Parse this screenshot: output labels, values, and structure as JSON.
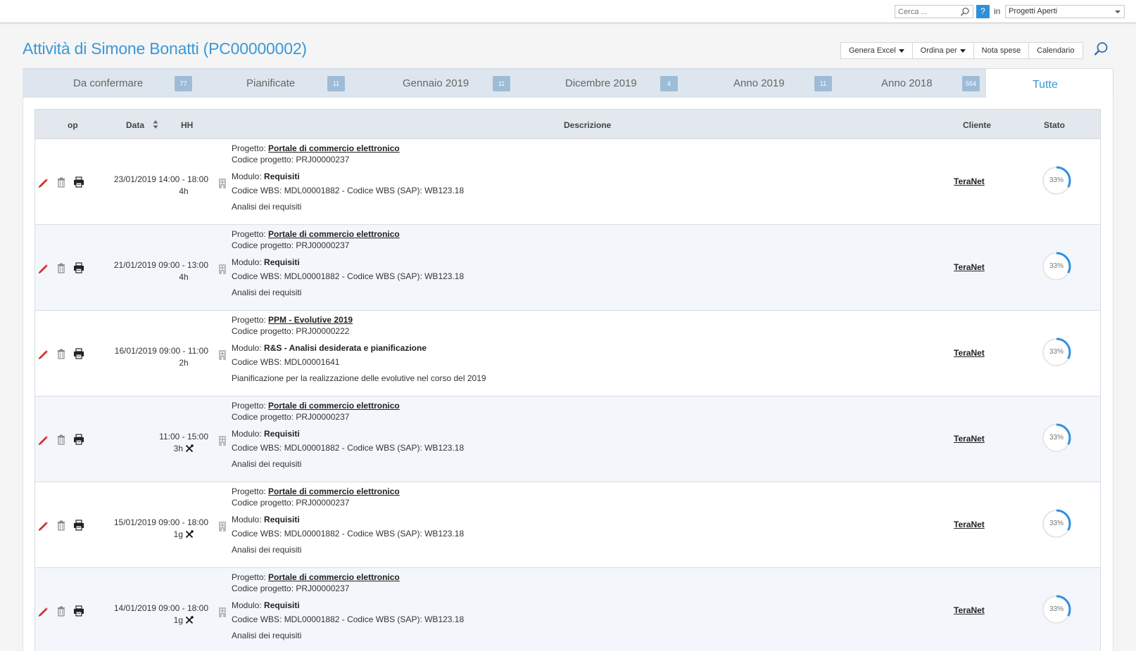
{
  "topbar": {
    "search_placeholder": "Cerca ...",
    "help_label": "?",
    "in_label": "in",
    "scope_value": "Progetti Aperti"
  },
  "page": {
    "title": "Attività di Simone Bonatti (PC00000002)"
  },
  "toolbar": {
    "excel_label": "Genera Excel",
    "sort_label": "Ordina per",
    "expenses_label": "Nota spese",
    "calendar_label": "Calendario"
  },
  "tabs": [
    {
      "label": "Da confermare",
      "count": "77"
    },
    {
      "label": "Pianificate",
      "count": "11"
    },
    {
      "label": "Gennaio 2019",
      "count": "11"
    },
    {
      "label": "Dicembre 2019",
      "count": "4"
    },
    {
      "label": "Anno 2019",
      "count": "11"
    },
    {
      "label": "Anno 2018",
      "count": "554"
    },
    {
      "label": "Tutte",
      "count": ""
    }
  ],
  "table": {
    "headers": {
      "op": "op",
      "date": "Data",
      "hh": "HH",
      "desc": "Descrizione",
      "client": "Cliente",
      "status": "Stato"
    },
    "project_prefix": "Progetto:",
    "module_prefix": "Modulo:",
    "rows": [
      {
        "date_time": "23/01/2019 14:00 - 18:00",
        "duration": "4h",
        "has_tool": false,
        "project": "Portale di commercio elettronico",
        "project_code": "Codice progetto: PRJ00000237",
        "module": "Requisiti",
        "wbs": "Codice WBS: MDL00001882 - Codice WBS (SAP): WB123.18",
        "note": "Analisi dei requisiti",
        "client": "TeraNet",
        "progress": "33%",
        "progress_value": 0.33
      },
      {
        "date_time": "21/01/2019 09:00 - 13:00",
        "duration": "4h",
        "has_tool": false,
        "project": "Portale di commercio elettronico",
        "project_code": "Codice progetto: PRJ00000237",
        "module": "Requisiti",
        "wbs": "Codice WBS: MDL00001882 - Codice WBS (SAP): WB123.18",
        "note": "Analisi dei requisiti",
        "client": "TeraNet",
        "progress": "33%",
        "progress_value": 0.33
      },
      {
        "date_time": "16/01/2019 09:00 - 11:00",
        "duration": "2h",
        "has_tool": false,
        "project": "PPM - Evolutive 2019",
        "project_code": "Codice progetto: PRJ00000222",
        "module": "R&S - Analisi desiderata e pianificazione",
        "wbs": "Codice WBS: MDL00001641",
        "note": "Pianificazione per la realizzazione delle evolutive nel corso del 2019",
        "client": "TeraNet",
        "progress": "33%",
        "progress_value": 0.33
      },
      {
        "date_time": "11:00 - 15:00",
        "duration": "3h",
        "has_tool": true,
        "project": "Portale di commercio elettronico",
        "project_code": "Codice progetto: PRJ00000237",
        "module": "Requisiti",
        "wbs": "Codice WBS: MDL00001882 - Codice WBS (SAP): WB123.18",
        "note": "Analisi dei requisiti",
        "client": "TeraNet",
        "progress": "33%",
        "progress_value": 0.33
      },
      {
        "date_time": "15/01/2019 09:00 - 18:00",
        "duration": "1g",
        "has_tool": true,
        "project": "Portale di commercio elettronico",
        "project_code": "Codice progetto: PRJ00000237",
        "module": "Requisiti",
        "wbs": "Codice WBS: MDL00001882 - Codice WBS (SAP): WB123.18",
        "note": "Analisi dei requisiti",
        "client": "TeraNet",
        "progress": "33%",
        "progress_value": 0.33
      },
      {
        "date_time": "14/01/2019 09:00 - 18:00",
        "duration": "1g",
        "has_tool": true,
        "project": "Portale di commercio elettronico",
        "project_code": "Codice progetto: PRJ00000237",
        "module": "Requisiti",
        "wbs": "Codice WBS: MDL00001882 - Codice WBS (SAP): WB123.18",
        "note": "Analisi dei requisiti",
        "client": "TeraNet",
        "progress": "33%",
        "progress_value": 0.33
      }
    ]
  },
  "colors": {
    "accent": "#3a98d6",
    "progress_arc": "#2f8fe0",
    "progress_track": "#e6e6e6",
    "edit_icon": "#d9302b"
  }
}
